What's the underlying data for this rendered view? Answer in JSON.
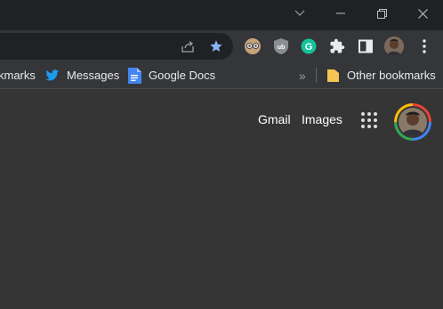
{
  "colors": {
    "titlebar": "#202124",
    "toolbar": "#35363a",
    "page_bg": "#353535",
    "omnibox": "#202124",
    "accent_star": "#8ab4f8",
    "text": "#e8eaed"
  },
  "window_controls": [
    "chevron-down-icon",
    "minimize-icon",
    "restore-icon",
    "close-icon"
  ],
  "omnibox": {
    "icons": [
      "share-icon",
      "bookmark-star-icon"
    ]
  },
  "extensions": [
    {
      "name": "glasses-extension-icon"
    },
    {
      "name": "ublock-extension-icon",
      "label": "ub"
    },
    {
      "name": "grammarly-extension-icon",
      "label": "G"
    },
    {
      "name": "extensions-puzzle-icon"
    },
    {
      "name": "side-panel-icon"
    },
    {
      "name": "profile-avatar-icon"
    },
    {
      "name": "menu-kebab-icon"
    }
  ],
  "bookmarks": {
    "items": [
      {
        "label": "kmarks",
        "icon": "none"
      },
      {
        "label": "Messages",
        "icon": "twitter-icon"
      },
      {
        "label": "Google Docs",
        "icon": "google-docs-icon"
      }
    ],
    "overflow": "»",
    "other": {
      "label": "Other bookmarks",
      "icon": "folder-icon"
    }
  },
  "page": {
    "links": {
      "gmail": "Gmail",
      "images": "Images"
    },
    "apps_icon": "apps-grid-icon",
    "account_avatar": "account-avatar"
  }
}
